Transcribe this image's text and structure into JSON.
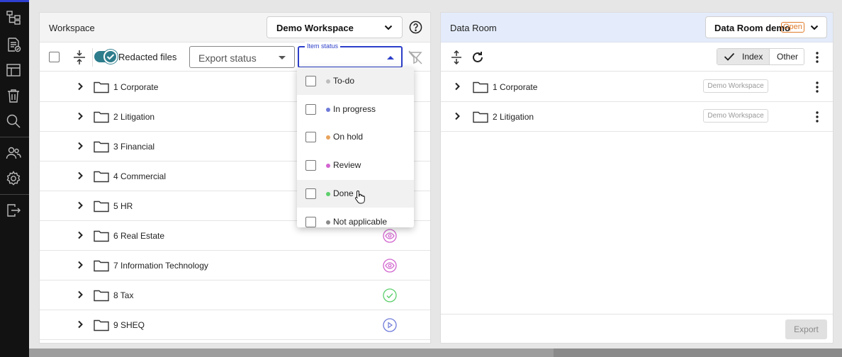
{
  "rail": {
    "items": [
      {
        "icon": "hierarchy-icon"
      },
      {
        "icon": "document-check-icon"
      },
      {
        "icon": "layout-icon"
      },
      {
        "icon": "trash-icon"
      },
      {
        "icon": "search-icon"
      },
      {
        "icon": "users-icon"
      },
      {
        "icon": "settings-icon"
      },
      {
        "icon": "logout-icon"
      }
    ]
  },
  "workspace": {
    "title": "Workspace",
    "selected_workspace": "Demo Workspace",
    "toolbar": {
      "toggle_label": "Redacted files",
      "toggle_on": true,
      "export_status_placeholder": "Export status",
      "item_status_label": "Item status",
      "item_status_value": ""
    },
    "rows": [
      {
        "name": "1 Corporate",
        "status": ""
      },
      {
        "name": "2 Litigation",
        "status": ""
      },
      {
        "name": "3 Financial",
        "status": ""
      },
      {
        "name": "4 Commercial",
        "status": ""
      },
      {
        "name": "5 HR",
        "status": ""
      },
      {
        "name": "6 Real Estate",
        "status": "review"
      },
      {
        "name": "7 Information Technology",
        "status": "review"
      },
      {
        "name": "8 Tax",
        "status": "done"
      },
      {
        "name": "9 SHEQ",
        "status": "in-progress"
      }
    ]
  },
  "item_status_menu": {
    "options": [
      {
        "label": "To-do",
        "color": "#bdbdbd",
        "checked": false
      },
      {
        "label": "In progress",
        "color": "#6f7bd9",
        "checked": false
      },
      {
        "label": "On hold",
        "color": "#e8a35c",
        "checked": false
      },
      {
        "label": "Review",
        "color": "#d264cf",
        "checked": false
      },
      {
        "label": "Done",
        "color": "#5ccf6c",
        "checked": false
      },
      {
        "label": "Not applicable",
        "color": "#8a8a8a",
        "checked": false
      }
    ],
    "hovered": "Done"
  },
  "data_room": {
    "title": "Data Room",
    "selected_room": "Data Room demo",
    "room_badge": "Open",
    "view_toggle": {
      "index_label": "Index",
      "other_label": "Other",
      "selected": "Index"
    },
    "rows": [
      {
        "name": "1 Corporate",
        "tag": "Demo Workspace"
      },
      {
        "name": "2 Litigation",
        "tag": "Demo Workspace"
      }
    ],
    "export_label": "Export"
  },
  "colors": {
    "accent": "#2c3ec9",
    "toggle": "#2e7d8c",
    "review": "#d264cf",
    "done": "#5ccf6c",
    "in_progress": "#6f7bd9",
    "open_badge": "#e07b2a",
    "data_room_header": "#e4ecfb"
  }
}
